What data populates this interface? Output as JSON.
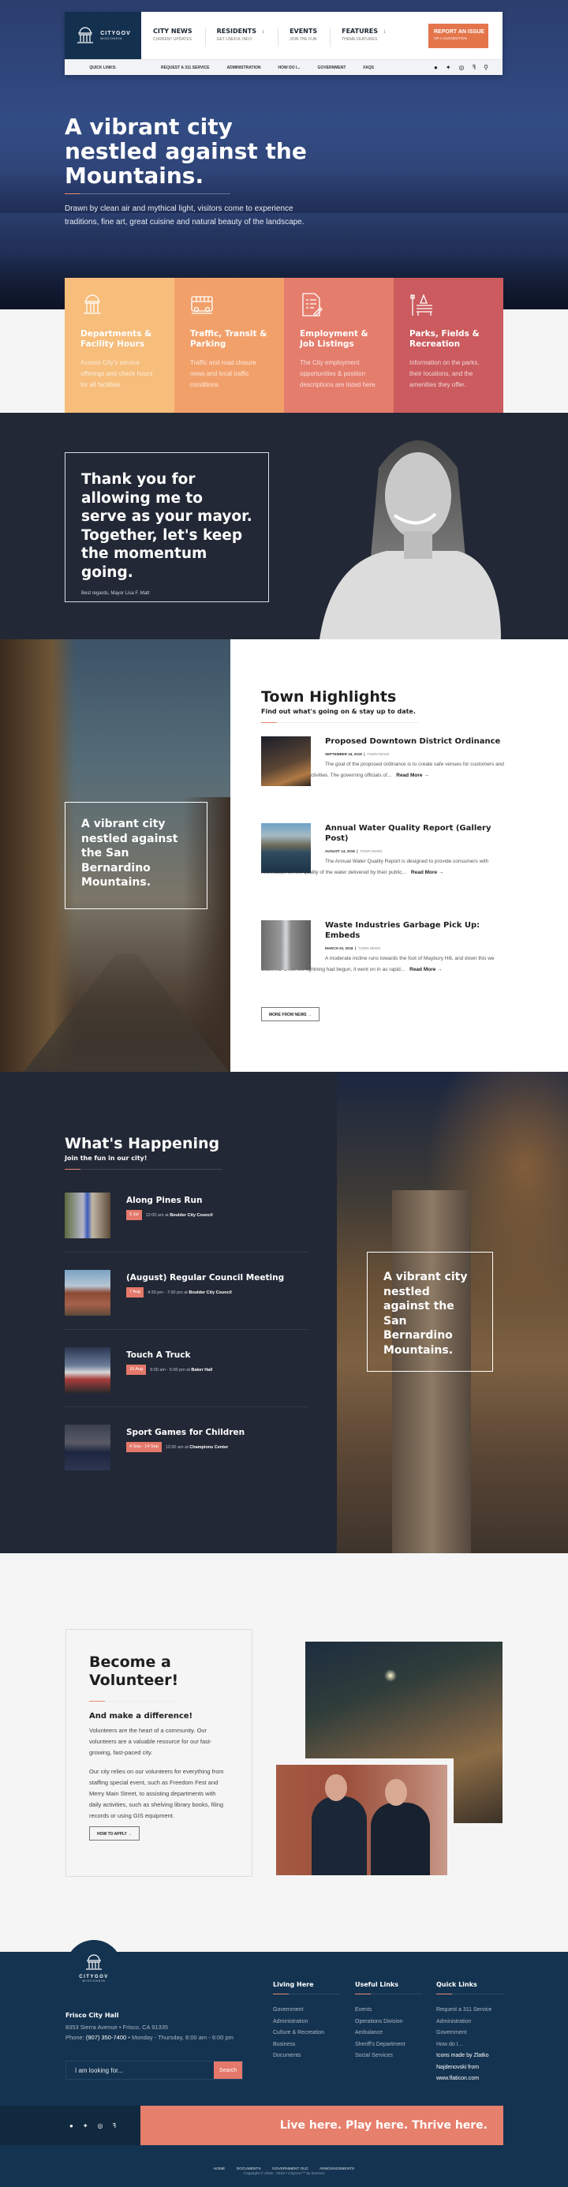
{
  "header": {
    "logo": {
      "name": "CITYGOV",
      "sub": "WISCONSIN"
    },
    "nav": [
      {
        "label": "CITY NEWS",
        "sub": "CURRENT UPDATES",
        "dropdown": false
      },
      {
        "label": "RESIDENTS",
        "sub": "GET USEFUL INFO",
        "dropdown": true
      },
      {
        "label": "EVENTS",
        "sub": "JOIN THE FUN",
        "dropdown": false
      },
      {
        "label": "FEATURES",
        "sub": "THEME FEATURES",
        "dropdown": true
      }
    ],
    "report": {
      "label": "REPORT AN ISSUE",
      "sub": "OR A SUGGESTION"
    },
    "quick_links_label": "QUICK LINKS:",
    "quick_links": [
      "REQUEST A 311 SERVICE",
      "ADMINISTRATION",
      "HOW DO I...",
      "GOVERNMENT",
      "FAQS"
    ],
    "social_icons": [
      "facebook-icon",
      "twitter-icon",
      "instagram-icon",
      "foursquare-icon",
      "search-icon"
    ]
  },
  "hero": {
    "title": "A vibrant city nestled against the Mountains.",
    "text": "Drawn by clean air and mythical light, visitors come to experience traditions, fine art, great cuisine and natural beauty of the landscape."
  },
  "cards": [
    {
      "icon": "capitol-building-icon",
      "title": "Departments & Facility Hours",
      "text": "Access City's service offerings and check hours for all facilities.",
      "color": "#f6bd7b"
    },
    {
      "icon": "bus-icon",
      "title": "Traffic, Transit & Parking",
      "text": "Traffic and road closure news and local traffic conditions",
      "color": "#f2a06a"
    },
    {
      "icon": "job-document-icon",
      "title": "Employment & Job Listings",
      "text": "The City employment opportunities & position descriptions are listed here.",
      "color": "#e57d6c"
    },
    {
      "icon": "park-bench-icon",
      "title": "Parks, Fields & Recreation",
      "text": "Information on the parks, their locations, and the amenities they offer.",
      "color": "#cb5b5e"
    }
  ],
  "mayor": {
    "quote": "Thank you for allowing me to serve as your mayor. Together, let's keep the momentum going.",
    "signature": "Best regards, Mayor Lisa F. Matt"
  },
  "town_highlights": {
    "overlay_text": "A vibrant city nestled against the San Bernardino Mountains.",
    "title": "Town Highlights",
    "subtitle": "Find out what's going on & stay up to date.",
    "posts": [
      {
        "title": "Proposed Downtown District Ordinance",
        "date": "SEPTEMBER 16, 2018",
        "category": "TOWN NEWS",
        "excerpt": "The goal of the proposed ordinance is to create safe venues for customers and to discourage illegal activities. The governing officials of...",
        "read_more": "Read More →"
      },
      {
        "title": "Annual Water Quality Report (Gallery Post)",
        "date": "AUGUST 14, 2018",
        "category": "TOWN NEWS",
        "excerpt": "The Annual Water Quality Report is designed to provide consumers with information on the quality of the water delivered by their public...",
        "read_more": "Read More →"
      },
      {
        "title": "Waste Industries Garbage Pick Up: Embeds",
        "date": "MARCH 20, 2018",
        "category": "TOWN NEWS",
        "excerpt": "A moderate incline runs towards the foot of Maybury Hill, and down this we clattered. Once the lightning had begun, it went on in as rapid...",
        "read_more": "Read More →"
      }
    ],
    "more_button": "MORE FROM NEWS →"
  },
  "events": {
    "title": "What's Happening",
    "subtitle": "Join the fun in our city!",
    "items": [
      {
        "title": "Along Pines Run",
        "date": "5 Jul",
        "time": "12:00 am at",
        "venue": "Boulder City Council"
      },
      {
        "title": "(August) Regular Council Meeting",
        "date": "7 Aug",
        "time": "4:30 pm - 7:30 pm at",
        "venue": "Boulder City Council"
      },
      {
        "title": "Touch A Truck",
        "date": "16 Aug",
        "time": "9:00 am - 5:00 pm at",
        "venue": "Baker Hall"
      },
      {
        "title": "Sport Games for Children",
        "date": "4 Sep - 14 Sep",
        "time": "12:00 am at",
        "venue": "Champions Center"
      }
    ],
    "overlay_text": "A vibrant city nestled against the San Bernardino Mountains."
  },
  "volunteer": {
    "title": "Become a Volunteer!",
    "subtitle": "And make a difference!",
    "p1": "Volunteers are the heart of a community. Our volunteers are a valuable resource for our fast-growing, fast-paced city.",
    "p2": "Our city relies on our volunteers for everything from staffing special event, such as Freedom Fest and Merry Main Street, to assisting departments with daily activities, such as shelving library books, filing records or using GIS equipment.",
    "button": "HOW TO APPLY →"
  },
  "footer": {
    "logo": {
      "name": "CITYGOV",
      "sub": "WISCONSIN"
    },
    "city_hall": "Frisco City Hall",
    "address": "8353 Sierra Avenue • Frisco, CA 91335",
    "phone_label": "Phone:",
    "phone": "(907) 350-7400",
    "hours": "• Monday - Thursday, 8:00 am - 6:00 pm",
    "search_placeholder": "I am looking for...",
    "search_button": "Search",
    "columns": [
      {
        "title": "Living Here",
        "links": [
          "Government",
          "Administration",
          "Culture & Recreation",
          "Business",
          "Documents"
        ]
      },
      {
        "title": "Useful Links",
        "links": [
          "Events",
          "Operations Division",
          "Ambulance",
          "Sheriff's Department",
          "Social Services"
        ]
      },
      {
        "title": "Quick Links",
        "links": [
          "Request a 311 Service",
          "Administration",
          "Government",
          "How do I..."
        ],
        "note": "Icons made by Zlatko Najdenovski from www.flaticon.com"
      }
    ],
    "social_icons": [
      "facebook-icon",
      "twitter-icon",
      "instagram-icon",
      "foursquare-icon"
    ],
    "slogan": "Live here. Play here. Thrive here.",
    "bottom_links": [
      "HOME",
      "DOCUMENTS",
      "GOVERNMENT OLD",
      "ANNOUNCEMENTS"
    ],
    "copyright": "Copyright © 2018 - 2023 • CityGov™ by Danneo"
  }
}
